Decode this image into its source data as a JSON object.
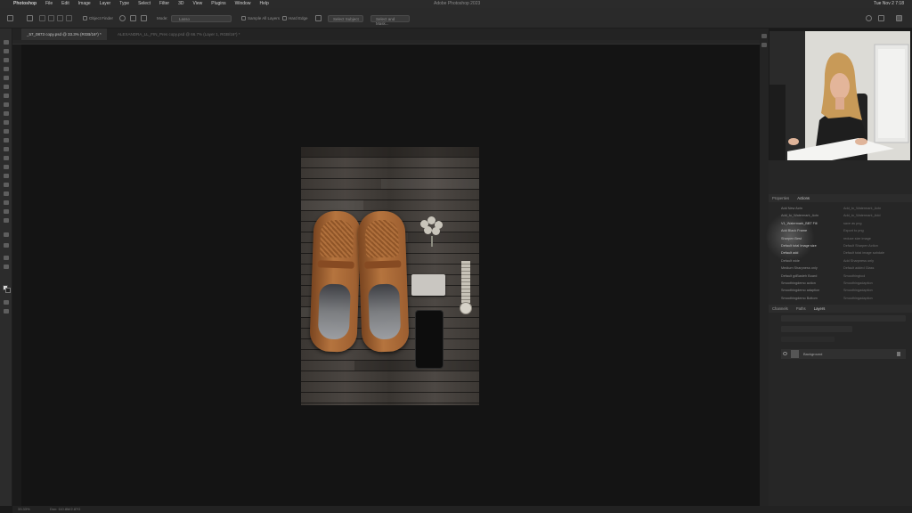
{
  "menubar": {
    "apple": "",
    "app": "Photoshop",
    "items": [
      "File",
      "Edit",
      "Image",
      "Layer",
      "Type",
      "Select",
      "Filter",
      "3D",
      "View",
      "Plugins",
      "Window",
      "Help"
    ],
    "window_title": "Adobe Photoshop 2023",
    "clock": "Tue Nov 2 7:18"
  },
  "options": {
    "object_finder": "Object Finder",
    "mode_label": "Mode:",
    "mode_value": "Lasso",
    "sample_all": "Sample All Layers",
    "hard_edge": "Hard Edge",
    "select_subject": "Select Subject",
    "select_mask": "Select and Mask..."
  },
  "tabs": {
    "active": "_57_0873 copy.psd @ 33.3% (RGB/16*) *",
    "inactive": "ALEXANDRA_LL_FIN_Pres copy.psd @ 66.7% (Layer 1, RGB/16*) *"
  },
  "panels": {
    "top_tabs": [
      "Properties",
      "Actions"
    ],
    "bottom_tabs": [
      "Channels",
      "Paths",
      "Layers"
    ],
    "actions_col1": [
      "Add New Actn",
      "Add_to_Watermark_Actn",
      "V1_Watermark_BBT Fill",
      "Add Black Frame",
      "Sharpen Best",
      "Default total Image size",
      "Default add",
      "Default wide",
      "Medium Sharpness only",
      "Default gdBasteh Board",
      "Smoothingdemo action",
      "Smoothingdemo adaption",
      "Smoothingdemo Bottom"
    ],
    "actions_col2": [
      "Add_to_Watermark_Actn",
      "Add_to_Watermark_Add",
      "save as png",
      "Export to png",
      "reduce size image",
      "Default Sharpen Action",
      "Default total image sahdale",
      "Add Sharpness only",
      "Default added Glass",
      "Smoothingtool",
      "Smoothingadaption",
      "Smoothingadaption",
      "Smoothingadaption"
    ],
    "actions_bold_rows": [
      2,
      3,
      4,
      5,
      6
    ],
    "layer_name": "Background"
  },
  "status": {
    "zoom": "33.33%",
    "doc": "Doc: 110.8M/2.87G"
  },
  "colors": {
    "bg": "#1a1a1a",
    "panel": "#262626",
    "canvas": "#141414"
  }
}
